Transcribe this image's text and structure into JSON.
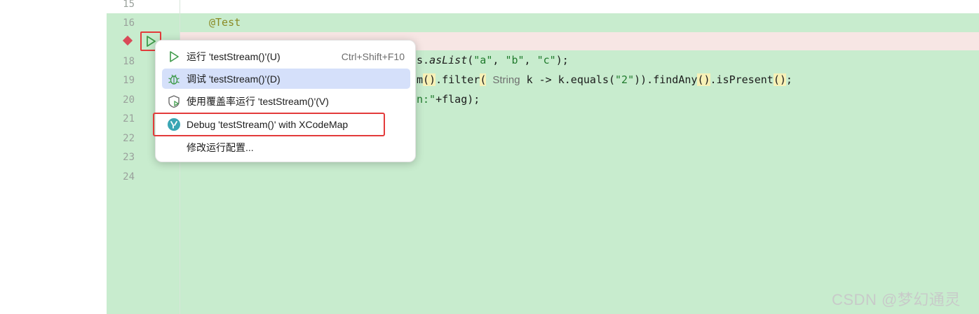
{
  "editor": {
    "line_numbers": [
      "15",
      "16",
      "18",
      "19",
      "20",
      "21",
      "22",
      "23",
      "24"
    ],
    "code": {
      "annotation": "@Test",
      "line18_plain": "s.",
      "line18_method": "asList",
      "line18_str_a": "\"a\"",
      "line18_sep1": ", ",
      "line18_str_b": "\"b\"",
      "line18_sep2": ", ",
      "line18_str_c": "\"c\"",
      "line18_end": ");",
      "line19_prefix": "m",
      "line19_paren": "()",
      "line19_filter": ".filter",
      "line19_open": "(",
      "line19_hint": "String",
      "line19_mid": " k -> k.equals(",
      "line19_str": "\"2\"",
      "line19_rest": ")).findAny",
      "line19_paren2": "()",
      "line19_ispresent": ".isPresent",
      "line19_paren3": "()",
      "line19_end": ";",
      "line20_str": "n:\"",
      "line20_rest": "+flag);"
    }
  },
  "context_menu": {
    "items": [
      {
        "icon": "run-icon",
        "label": "运行 'testStream()'(U)",
        "shortcut": "Ctrl+Shift+F10"
      },
      {
        "icon": "debug-icon",
        "label": "调试 'testStream()'(D)"
      },
      {
        "icon": "coverage-icon",
        "label": "使用覆盖率运行 'testStream()'(V)"
      },
      {
        "icon": "xcodemap-icon",
        "label": "Debug 'testStream()' with XCodeMap"
      },
      {
        "label": "修改运行配置..."
      }
    ]
  },
  "watermark": "CSDN @梦幻通灵",
  "colors": {
    "editor_bg": "#c8ecce",
    "highlight_red": "#e33b3b",
    "menu_selected": "#d5e0fa",
    "breakpoint": "#d94a58"
  }
}
